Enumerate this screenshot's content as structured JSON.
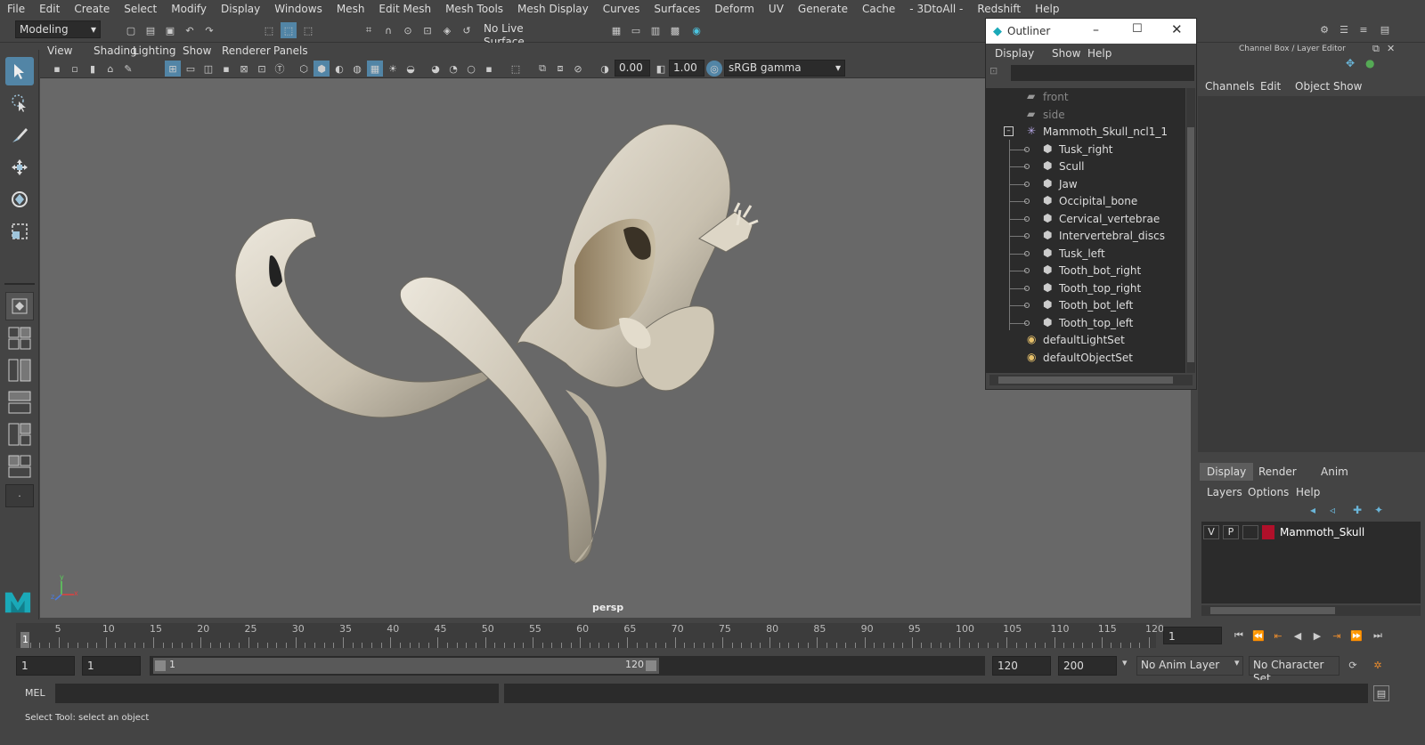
{
  "menubar": {
    "items": [
      "File",
      "Edit",
      "Create",
      "Select",
      "Modify",
      "Display",
      "Windows",
      "Mesh",
      "Edit Mesh",
      "Mesh Tools",
      "Mesh Display",
      "Curves",
      "Surfaces",
      "Deform",
      "UV",
      "Generate",
      "Cache",
      "- 3DtoAll -",
      "Redshift",
      "Help"
    ]
  },
  "shelf": {
    "mode": "Modeling",
    "live_surface": "No Live Surface"
  },
  "panel_menu": [
    "View",
    "Shading",
    "Lighting",
    "Show",
    "Renderer",
    "Panels"
  ],
  "viewport_toolbar": {
    "exposure": "0.00",
    "gamma": "1.00",
    "color_space": "sRGB gamma"
  },
  "viewport": {
    "camera_label": "persp",
    "axis_x": "x",
    "axis_y": "y",
    "axis_z": "z"
  },
  "outliner": {
    "title": "Outliner",
    "menu": [
      "Display",
      "Show",
      "Help"
    ],
    "items": [
      {
        "label": "front",
        "dim": true
      },
      {
        "label": "side",
        "dim": true
      },
      {
        "label": "Mammoth_Skull_ncl1_1"
      },
      {
        "label": "Tusk_right"
      },
      {
        "label": "Scull"
      },
      {
        "label": "Jaw"
      },
      {
        "label": "Occipital_bone"
      },
      {
        "label": "Cervical_vertebrae"
      },
      {
        "label": "Intervertebral_discs"
      },
      {
        "label": "Tusk_left"
      },
      {
        "label": "Tooth_bot_right"
      },
      {
        "label": "Tooth_top_right"
      },
      {
        "label": "Tooth_bot_left"
      },
      {
        "label": "Tooth_top_left"
      },
      {
        "label": "defaultLightSet"
      },
      {
        "label": "defaultObjectSet"
      }
    ]
  },
  "channel_box": {
    "title": "Channel Box / Layer Editor",
    "menu": [
      "Channels",
      "Edit",
      "Object",
      "Show"
    ]
  },
  "layer_editor": {
    "tabs": [
      "Display",
      "Render",
      "Anim"
    ],
    "menu": [
      "Layers",
      "Options",
      "Help"
    ],
    "layer": {
      "v": "V",
      "p": "P",
      "name": "Mammoth_Skull",
      "color": "#b0102a"
    }
  },
  "timeline": {
    "ticks": [
      "5",
      "10",
      "15",
      "20",
      "25",
      "30",
      "35",
      "40",
      "45",
      "50",
      "55",
      "60",
      "65",
      "70",
      "75",
      "80",
      "85",
      "90",
      "95",
      "100",
      "105",
      "110",
      "115",
      "120"
    ],
    "current_marker": "1",
    "current_frame": "1"
  },
  "range": {
    "start": "1",
    "start_inner": "1",
    "slider_start": "1",
    "slider_end": "120",
    "end_inner": "120",
    "end": "200",
    "anim_layer": "No Anim Layer",
    "char_set": "No Character Set"
  },
  "cmd": {
    "lang": "MEL"
  },
  "status": {
    "text": "Select Tool: select an object"
  },
  "colors": {
    "accent": "#5285a6",
    "bone": "#d9d2c3"
  }
}
